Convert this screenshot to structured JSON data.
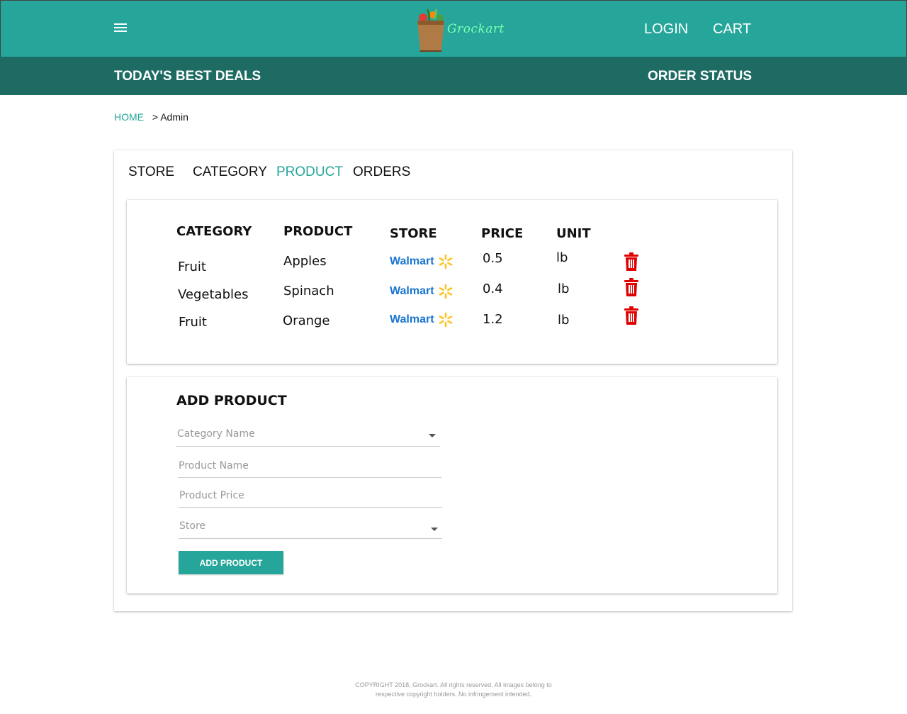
{
  "header": {
    "logo_text": "Grockart",
    "login_label": "LOGIN",
    "cart_label": "CART"
  },
  "subnav": {
    "deals_label": "TODAY'S BEST DEALS",
    "status_label": "ORDER STATUS"
  },
  "breadcrumb": {
    "home": "HOME",
    "separator": ">",
    "current": "Admin"
  },
  "tabs": [
    {
      "label": "STORE",
      "active": false
    },
    {
      "label": "CATEGORY",
      "active": false
    },
    {
      "label": "PRODUCT",
      "active": true
    },
    {
      "label": "ORDERS",
      "active": false
    }
  ],
  "table": {
    "headers": [
      "CATEGORY",
      "PRODUCT",
      "STORE",
      "PRICE",
      "UNIT"
    ],
    "rows": [
      {
        "category": "Fruit",
        "product": "Apples",
        "store": "Walmart",
        "price": "0.5",
        "unit": "lb"
      },
      {
        "category": "Vegetables",
        "product": "Spinach",
        "store": "Walmart",
        "price": "0.4",
        "unit": "lb"
      },
      {
        "category": "Fruit",
        "product": "Orange",
        "store": "Walmart",
        "price": "1.2",
        "unit": "lb"
      }
    ]
  },
  "add_form": {
    "title": "ADD PRODUCT",
    "category_placeholder": "Category Name",
    "name_placeholder": "Product Name",
    "price_placeholder": "Product Price",
    "store_placeholder": "Store",
    "submit_label": "ADD PRODUCT"
  },
  "footer": {
    "line1": "COPYRIGHT 2018, Grockart. All rights reserved. All images belong to",
    "line2": "respective copyright holders. No infringement intended."
  },
  "colors": {
    "primary": "#26a69a",
    "primary_dark": "#1d6b63",
    "walmart_blue": "#1a75cf",
    "walmart_spark": "#ffc220",
    "delete_red": "#e00000"
  },
  "icons": {
    "menu": "hamburger-menu-icon",
    "delete": "trash-icon",
    "dropdown": "caret-down-icon",
    "logo": "grocery-bag-icon"
  }
}
